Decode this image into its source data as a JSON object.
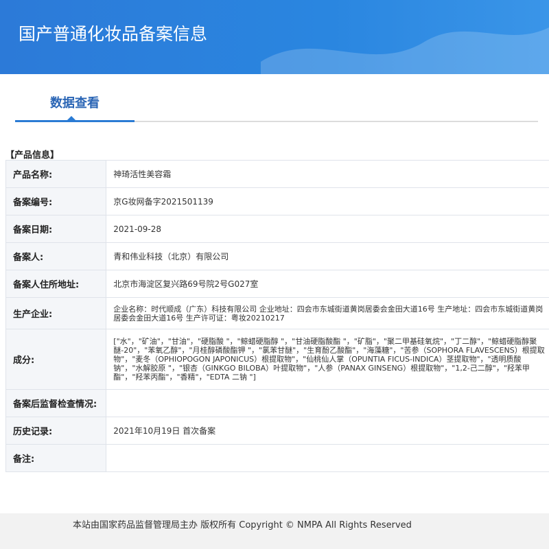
{
  "header": {
    "title": "国产普通化妆品备案信息"
  },
  "tabs": {
    "active_label": "数据查看"
  },
  "section": {
    "title": "【产品信息】"
  },
  "rows": [
    {
      "label": "产品名称:",
      "value": "神琦活性美容霜"
    },
    {
      "label": "备案编号:",
      "value": "京G妆网备字2021501139"
    },
    {
      "label": "备案日期:",
      "value": "2021-09-28"
    },
    {
      "label": "备案人:",
      "value": "青和伟业科技（北京）有限公司"
    },
    {
      "label": "备案人住所地址:",
      "value": "北京市海淀区复兴路69号院2号G027室"
    },
    {
      "label": "生产企业:",
      "value": "企业名称：时代顺成（广东）科技有限公司 企业地址：四会市东城街道黄岗居委会金田大道16号 生产地址：四会市东城街道黄岗居委会金田大道16号 生产许可证：粤妆20210217"
    },
    {
      "label": "成分:",
      "value": "[\"水\"，\"矿油\"，\"甘油\"，\"硬脂酸 \"，\"鲸蜡硬脂醇 \"，\"甘油硬脂酸酯 \"，\"矿脂\"，\"聚二甲基硅氧烷\"，\"丁二醇\"，\"鲸蜡硬脂醇聚醚-20\"，\"苯氧乙醇\"，\"月桂醇磷酸酯钾 \"，\"氯苯甘醚\"，\"生育酚乙酸酯\"，\"海藻糖\"，\"苦参（SOPHORA FLAVESCENS）根提取物\"，\"麦冬（OPHIOPOGON JAPONICUS）根提取物\"，\"仙桃仙人掌（OPUNTIA FICUS-INDICA）茎提取物\"，\"透明质酸钠\"，\"水解胶原 \"，\"银杏（GINKGO BILOBA）叶提取物\"，\"人参（PANAX GINSENG）根提取物\"，\"1,2-己二醇\"，\"羟苯甲酯\"，\"羟苯丙酯\"，\"香精\"，\"EDTA 二钠 \"]"
    },
    {
      "label": "备案后监督检查情况:",
      "value": ""
    },
    {
      "label": "历史记录:",
      "value": "2021年10月19日 首次备案"
    },
    {
      "label": "备注:",
      "value": ""
    }
  ],
  "footer": {
    "text": "本站由国家药品监督管理局主办 版权所有 Copyright © NMPA All Rights Reserved"
  }
}
